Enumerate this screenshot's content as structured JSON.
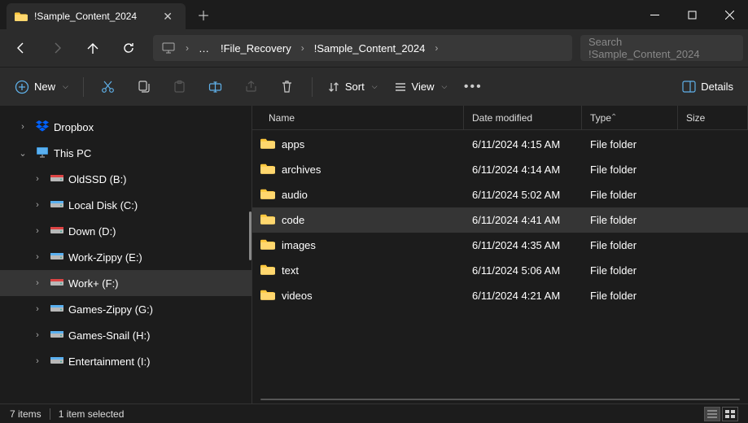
{
  "tab": {
    "title": "!Sample_Content_2024"
  },
  "breadcrumb": {
    "items": [
      "!File_Recovery",
      "!Sample_Content_2024"
    ]
  },
  "search": {
    "placeholder": "Search !Sample_Content_2024"
  },
  "toolbar": {
    "new_label": "New",
    "sort_label": "Sort",
    "view_label": "View",
    "details_label": "Details"
  },
  "sidebar": {
    "items": [
      {
        "label": "Dropbox",
        "icon": "dropbox",
        "indent": 1,
        "expand": "closed"
      },
      {
        "label": "This PC",
        "icon": "pc",
        "indent": 1,
        "expand": "open"
      },
      {
        "label": "OldSSD (B:)",
        "icon": "drive-red",
        "indent": 2,
        "expand": "closed"
      },
      {
        "label": "Local Disk (C:)",
        "icon": "drive",
        "indent": 2,
        "expand": "closed"
      },
      {
        "label": "Down (D:)",
        "icon": "drive-red",
        "indent": 2,
        "expand": "closed"
      },
      {
        "label": "Work-Zippy (E:)",
        "icon": "drive",
        "indent": 2,
        "expand": "closed"
      },
      {
        "label": "Work+ (F:)",
        "icon": "drive-red",
        "indent": 2,
        "expand": "closed",
        "selected": true
      },
      {
        "label": "Games-Zippy (G:)",
        "icon": "drive",
        "indent": 2,
        "expand": "closed"
      },
      {
        "label": "Games-Snail (H:)",
        "icon": "drive",
        "indent": 2,
        "expand": "closed"
      },
      {
        "label": "Entertainment (I:)",
        "icon": "drive",
        "indent": 2,
        "expand": "closed"
      }
    ]
  },
  "columns": {
    "name": "Name",
    "date": "Date modified",
    "type": "Type",
    "size": "Size"
  },
  "files": [
    {
      "name": "apps",
      "date": "6/11/2024 4:15 AM",
      "type": "File folder",
      "size": "",
      "selected": false
    },
    {
      "name": "archives",
      "date": "6/11/2024 4:14 AM",
      "type": "File folder",
      "size": "",
      "selected": false
    },
    {
      "name": "audio",
      "date": "6/11/2024 5:02 AM",
      "type": "File folder",
      "size": "",
      "selected": false
    },
    {
      "name": "code",
      "date": "6/11/2024 4:41 AM",
      "type": "File folder",
      "size": "",
      "selected": true
    },
    {
      "name": "images",
      "date": "6/11/2024 4:35 AM",
      "type": "File folder",
      "size": "",
      "selected": false
    },
    {
      "name": "text",
      "date": "6/11/2024 5:06 AM",
      "type": "File folder",
      "size": "",
      "selected": false
    },
    {
      "name": "videos",
      "date": "6/11/2024 4:21 AM",
      "type": "File folder",
      "size": "",
      "selected": false
    }
  ],
  "status": {
    "count": "7 items",
    "selection": "1 item selected"
  }
}
